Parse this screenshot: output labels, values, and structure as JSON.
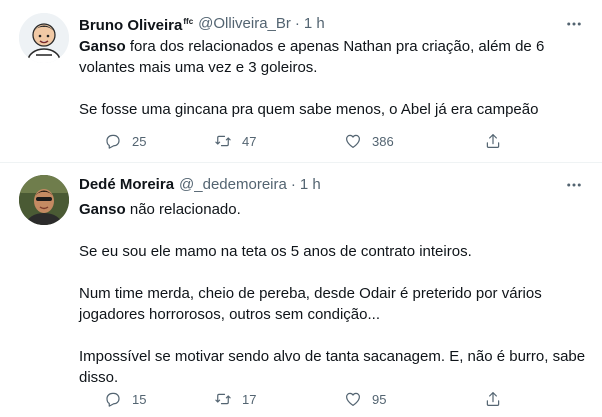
{
  "tweets": [
    {
      "name": "Bruno Oliveira",
      "name_sup": "ffc",
      "handle": "@Olliveira_Br",
      "separator": "·",
      "time": "1 h",
      "lines": [
        {
          "bold": "Ganso",
          "text": " fora dos relacionados e apenas Nathan pra criação, além de 6"
        },
        {
          "bold": "",
          "text": "volantes mais uma vez e 3 goleiros."
        },
        {
          "bold": "",
          "text": ""
        },
        {
          "bold": "",
          "text": "Se fosse uma gincana pra quem sabe menos, o Abel já era campeão"
        }
      ],
      "replies": "25",
      "retweets": "47",
      "likes": "386",
      "icons": {
        "reply": "reply-icon",
        "retweet": "retweet-icon",
        "like": "heart-icon",
        "share": "share-icon",
        "more": "more-icon"
      }
    },
    {
      "name": "Dedé Moreira",
      "name_sup": "",
      "handle": "@_dedemoreira",
      "separator": "·",
      "time": "1 h",
      "lines": [
        {
          "bold": "Ganso",
          "text": " não relacionado."
        },
        {
          "bold": "",
          "text": ""
        },
        {
          "bold": "",
          "text": "Se eu sou ele mamo na teta os 5 anos de contrato inteiros."
        },
        {
          "bold": "",
          "text": ""
        },
        {
          "bold": "",
          "text": "Num time merda, cheio de pereba, desde Odair é preterido por vários"
        },
        {
          "bold": "",
          "text": "jogadores horrorosos, outros sem condição..."
        },
        {
          "bold": "",
          "text": ""
        },
        {
          "bold": "",
          "text": "Impossível se motivar sendo alvo de tanta sacanagem. E, não é burro, sabe"
        },
        {
          "bold": "",
          "text": "disso."
        }
      ],
      "replies": "15",
      "retweets": "17",
      "likes": "95",
      "icons": {
        "reply": "reply-icon",
        "retweet": "retweet-icon",
        "like": "heart-icon",
        "share": "share-icon",
        "more": "more-icon"
      }
    }
  ],
  "colors": {
    "text": "#0f1419",
    "secondary": "#536471",
    "divider": "#eff3f4"
  }
}
